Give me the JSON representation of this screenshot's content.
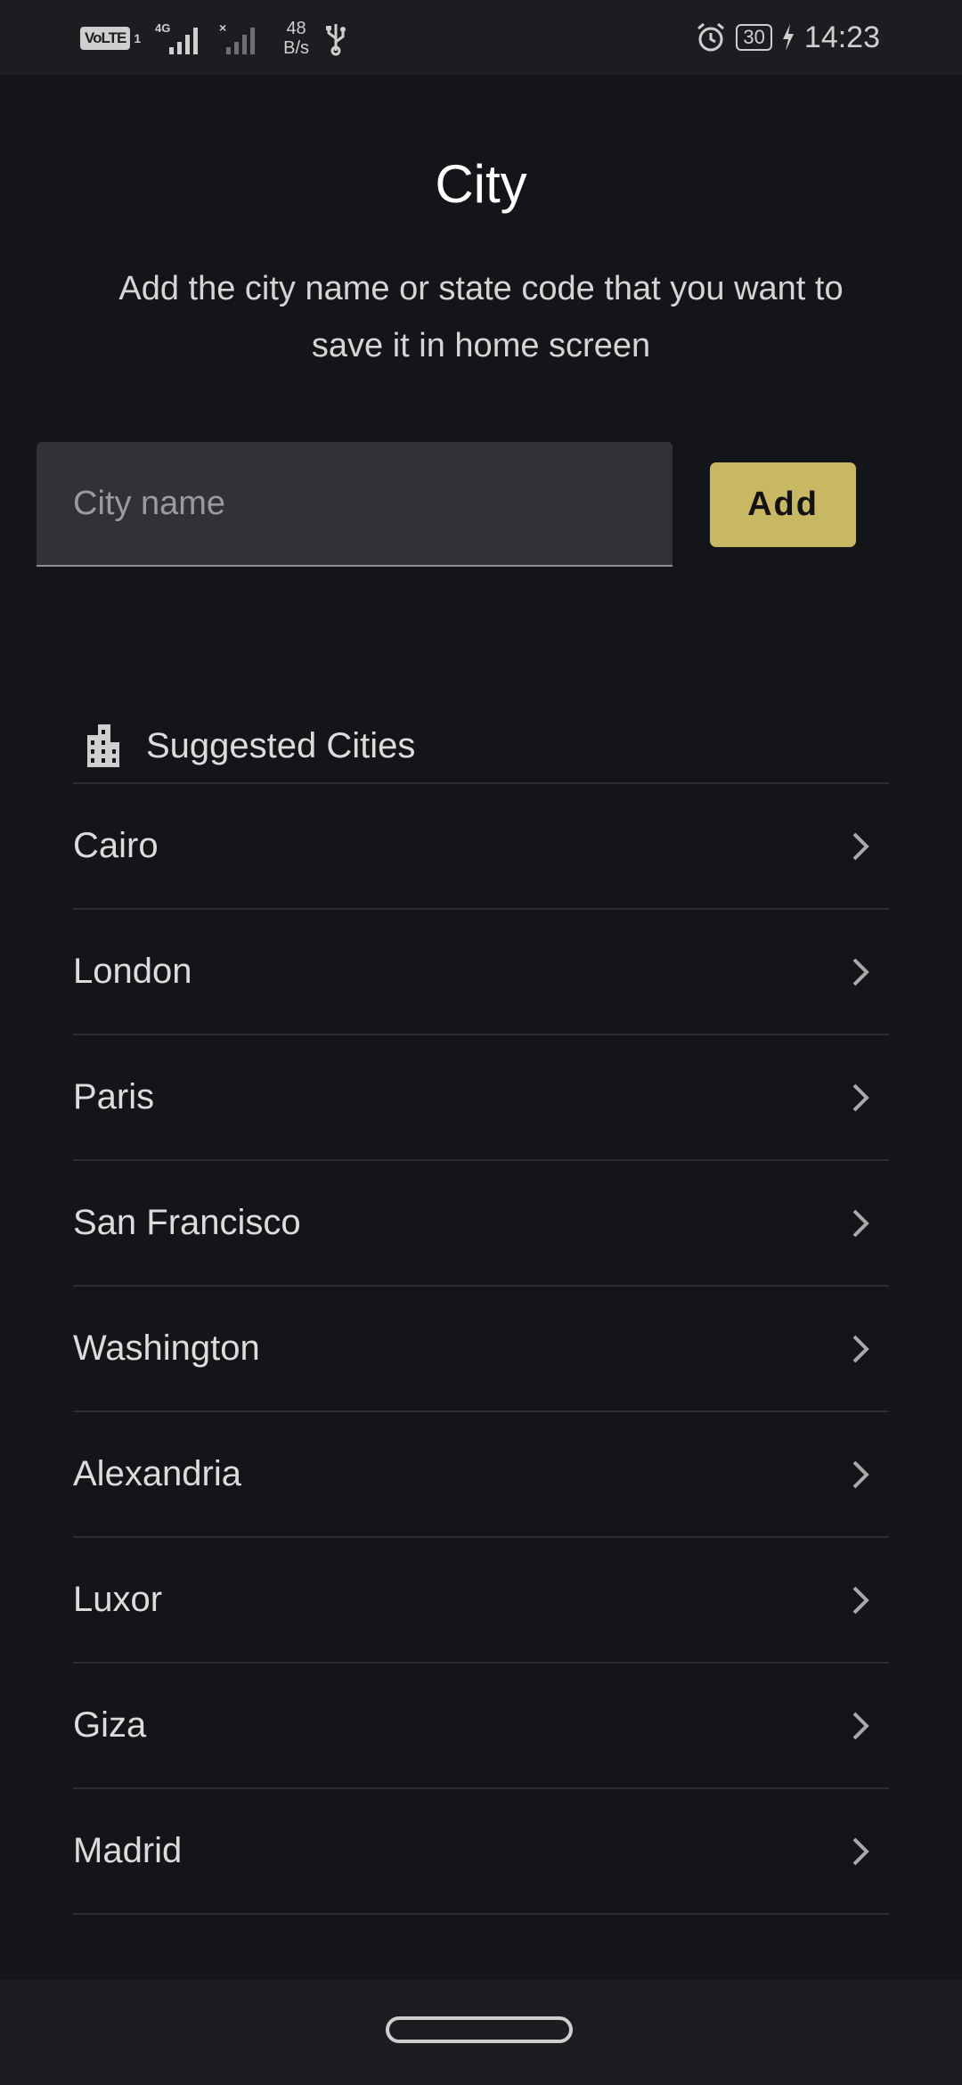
{
  "status_bar": {
    "volte": "VoLTE",
    "sim": "1",
    "network": "4G",
    "net_speed_value": "48",
    "net_speed_unit": "B/s",
    "battery": "30",
    "time": "14:23"
  },
  "header": {
    "title": "City",
    "subtitle": "Add the city name or state code that you want to save it in home screen"
  },
  "form": {
    "city_input_placeholder": "City name",
    "city_input_value": "",
    "add_label": "Add"
  },
  "suggested": {
    "title": "Suggested Cities",
    "icon": "building-icon",
    "cities": [
      "Cairo",
      "London",
      "Paris",
      "San Francisco",
      "Washington",
      "Alexandria",
      "Luxor",
      "Giza",
      "Madrid"
    ]
  },
  "colors": {
    "background": "#141519",
    "accent": "#c8b763",
    "input_bg": "#303236"
  }
}
